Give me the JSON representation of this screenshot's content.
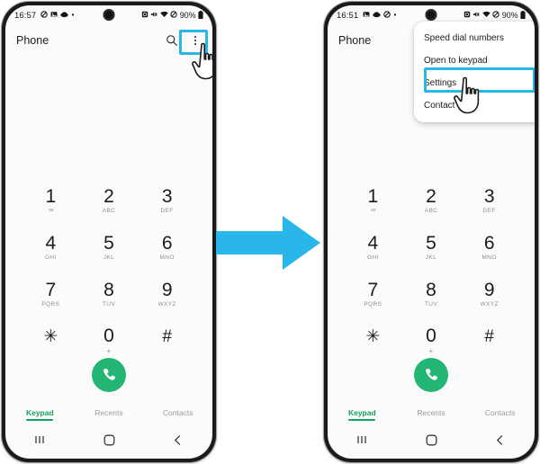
{
  "theme": {
    "accent_blue": "#29b6e8",
    "call_green": "#22b573",
    "tab_green": "#12a15c",
    "screen_bg": "#fbfbfb",
    "frame": "#1b1b1b"
  },
  "arrow": {
    "name": "right-arrow",
    "color": "#29b6e8"
  },
  "phone_left": {
    "status": {
      "time": "16:57",
      "left_icons": [
        "dnd-icon",
        "image-icon",
        "cloud-icon",
        "dot-icon"
      ],
      "right_icons": [
        "alarm-icon",
        "mute-icon",
        "wifi-icon",
        "do-not-disturb-icon"
      ],
      "battery_text": "90%",
      "battery_icon": "battery-icon"
    },
    "header": {
      "title": "Phone",
      "search_icon": "search-icon",
      "more_icon": "more-options-icon"
    },
    "keypad": [
      {
        "num": "1",
        "sub": "∞",
        "sub_type": "vm"
      },
      {
        "num": "2",
        "sub": "ABC",
        "sub_type": "letters"
      },
      {
        "num": "3",
        "sub": "DEF",
        "sub_type": "letters"
      },
      {
        "num": "4",
        "sub": "GHI",
        "sub_type": "letters"
      },
      {
        "num": "5",
        "sub": "JKL",
        "sub_type": "letters"
      },
      {
        "num": "6",
        "sub": "MNO",
        "sub_type": "letters"
      },
      {
        "num": "7",
        "sub": "PQRS",
        "sub_type": "letters"
      },
      {
        "num": "8",
        "sub": "TUV",
        "sub_type": "letters"
      },
      {
        "num": "9",
        "sub": "WXYZ",
        "sub_type": "letters"
      },
      {
        "num": "✳",
        "sub": "",
        "sub_type": "none"
      },
      {
        "num": "0",
        "sub": "+",
        "sub_type": "plus"
      },
      {
        "num": "#",
        "sub": "",
        "sub_type": "none"
      }
    ],
    "call_button": "call-button",
    "tabs": [
      {
        "label": "Keypad",
        "active": true
      },
      {
        "label": "Recents",
        "active": false
      },
      {
        "label": "Contacts",
        "active": false
      }
    ],
    "navbar": [
      "recents-nav-icon",
      "home-nav-icon",
      "back-nav-icon"
    ],
    "highlight": "more-options-icon"
  },
  "phone_right": {
    "status": {
      "time": "16:51",
      "left_icons": [
        "image-icon",
        "cloud-icon",
        "dnd-icon",
        "dot-icon"
      ],
      "right_icons": [
        "alarm-icon",
        "mute-icon",
        "wifi-icon",
        "do-not-disturb-icon"
      ],
      "battery_text": "90%",
      "battery_icon": "battery-icon"
    },
    "header": {
      "title": "Phone"
    },
    "menu": {
      "items": [
        {
          "label": "Speed dial numbers",
          "highlighted": false
        },
        {
          "label": "Open to keypad",
          "highlighted": false
        },
        {
          "label": "Settings",
          "highlighted": true
        },
        {
          "label": "Contact us",
          "highlighted": false
        }
      ]
    },
    "keypad": [
      {
        "num": "1",
        "sub": "∞",
        "sub_type": "vm"
      },
      {
        "num": "2",
        "sub": "ABC",
        "sub_type": "letters"
      },
      {
        "num": "3",
        "sub": "DEF",
        "sub_type": "letters"
      },
      {
        "num": "4",
        "sub": "GHI",
        "sub_type": "letters"
      },
      {
        "num": "5",
        "sub": "JKL",
        "sub_type": "letters"
      },
      {
        "num": "6",
        "sub": "MNO",
        "sub_type": "letters"
      },
      {
        "num": "7",
        "sub": "PQRS",
        "sub_type": "letters"
      },
      {
        "num": "8",
        "sub": "TUV",
        "sub_type": "letters"
      },
      {
        "num": "9",
        "sub": "WXYZ",
        "sub_type": "letters"
      },
      {
        "num": "✳",
        "sub": "",
        "sub_type": "none"
      },
      {
        "num": "0",
        "sub": "+",
        "sub_type": "plus"
      },
      {
        "num": "#",
        "sub": "",
        "sub_type": "none"
      }
    ],
    "call_button": "call-button",
    "tabs": [
      {
        "label": "Keypad",
        "active": true
      },
      {
        "label": "Recents",
        "active": false
      },
      {
        "label": "Contacts",
        "active": false
      }
    ],
    "navbar": [
      "recents-nav-icon",
      "home-nav-icon",
      "back-nav-icon"
    ],
    "highlight": "settings-menu-item"
  }
}
